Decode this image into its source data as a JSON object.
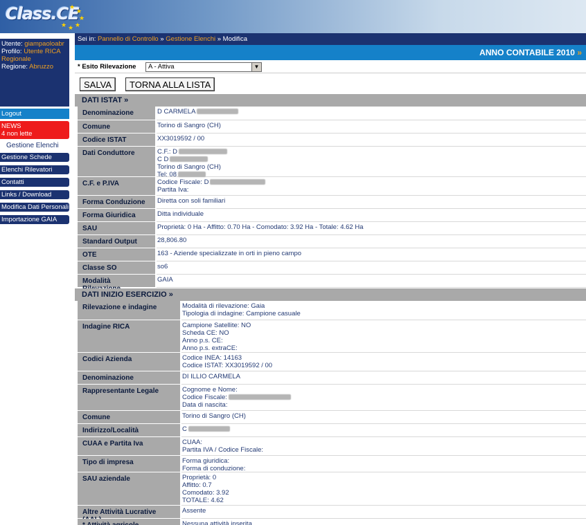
{
  "app": {
    "logo_text": "Class.CE"
  },
  "sidebar": {
    "user_label": "Utente: ",
    "user_value": "giampaoloabr",
    "profile_label": "Profilo: ",
    "profile_value": "Utente RICA Regionale",
    "region_label": "Regione: ",
    "region_value": "Abruzzo",
    "logout": "Logout",
    "news_title": "NEWS",
    "news_count": "4 non lette",
    "active_item": "Gestione Elenchi",
    "items": [
      {
        "label": "Gestione Schede"
      },
      {
        "label": "Elenchi Rilevatori"
      },
      {
        "label": "Contatti"
      },
      {
        "label": "Links / Download"
      },
      {
        "label": "Modifica Dati Personali"
      },
      {
        "label": "Importazione GAIA"
      }
    ]
  },
  "breadcrumb": {
    "prefix": "Sei in: ",
    "items": [
      "Pannello di Controllo",
      "Gestione Elenchi",
      "Modifica"
    ],
    "sep": " » "
  },
  "year_bar": {
    "label": "ANNO CONTABILE 2010",
    "arrow": "»"
  },
  "esito": {
    "label": "* Esito Rilevazione",
    "selected": "A - Attiva"
  },
  "buttons": {
    "save": "SALVA",
    "back": "TORNA ALLA LISTA"
  },
  "section_istat": {
    "title": "DATI ISTAT »"
  },
  "istat_rows": [
    {
      "label": "Denominazione",
      "lines": [
        "D        CARMELA"
      ]
    },
    {
      "label": "Comune",
      "lines": [
        "Torino di Sangro (CH)"
      ]
    },
    {
      "label": "Codice ISTAT",
      "lines": [
        "XX3019592 / 00"
      ]
    },
    {
      "label": "Dati Conduttore",
      "lines": [
        "C.F.: D",
        "C D",
        "Torino di Sangro (CH)",
        "Tel: 08"
      ]
    },
    {
      "label": "C.F. e P.IVA",
      "lines": [
        "Codice Fiscale: D",
        "Partita Iva:"
      ]
    },
    {
      "label": "Forma Conduzione",
      "lines": [
        "Diretta con soli familiari"
      ]
    },
    {
      "label": "Forma Giuridica",
      "lines": [
        "Ditta individuale"
      ]
    },
    {
      "label": "SAU",
      "lines": [
        "Proprietà: 0 Ha - Affitto: 0.70 Ha - Comodato: 3.92 Ha - Totale: 4.62 Ha"
      ]
    },
    {
      "label": "Standard Output",
      "lines": [
        "28,806.80"
      ]
    },
    {
      "label": "OTE",
      "lines": [
        "163 - Aziende specializzate in orti in pieno campo"
      ]
    },
    {
      "label": "Classe SO",
      "lines": [
        "so6"
      ]
    },
    {
      "label": "Modalità Rilevazione",
      "lines": [
        "GAIA"
      ]
    }
  ],
  "section_inizio": {
    "title": "DATI INIZIO ESERCIZIO »"
  },
  "inizio_rows": [
    {
      "label": "Rilevazione e indagine",
      "lines": [
        "Modalità di rilevazione: Gaia",
        "Tipologia di indagine: Campione casuale"
      ]
    },
    {
      "label": "Indagine RICA",
      "lines": [
        "Campione Satellite: NO",
        "Scheda CE: NO",
        "Anno p.s. CE:",
        "Anno p.s. extraCE:"
      ]
    },
    {
      "label": "Codici Azienda",
      "lines": [
        "Codice INEA: 14163",
        "Codice ISTAT: XX3019592 / 00"
      ]
    },
    {
      "label": "Denominazione",
      "lines": [
        "DI ILLIO CARMELA"
      ]
    },
    {
      "label": "Rappresentante Legale",
      "lines": [
        "Cognome e Nome:",
        "Codice Fiscale:",
        "Data di nascita:"
      ]
    },
    {
      "label": "Comune",
      "lines": [
        "Torino di Sangro (CH)"
      ]
    },
    {
      "label": "Indirizzo/Località",
      "lines": [
        "C"
      ]
    },
    {
      "label": "CUAA e Partita Iva",
      "lines": [
        "CUAA:",
        "Partita IVA / Codice Fiscale:"
      ]
    },
    {
      "label": "Tipo di impresa",
      "lines": [
        "Forma giuridica:",
        "Forma di conduzione:"
      ]
    },
    {
      "label": "SAU aziendale",
      "lines": [
        "Proprietà: 0",
        "Affitto: 0.7",
        "Comodato: 3.92",
        "TOTALE: 4.62"
      ]
    },
    {
      "label": "Altre Attività Lucrative (AAL)",
      "lines": [
        "Assente"
      ]
    },
    {
      "label": "* Attività agricole",
      "lines": [
        "Nessuna attività inserita"
      ]
    }
  ]
}
